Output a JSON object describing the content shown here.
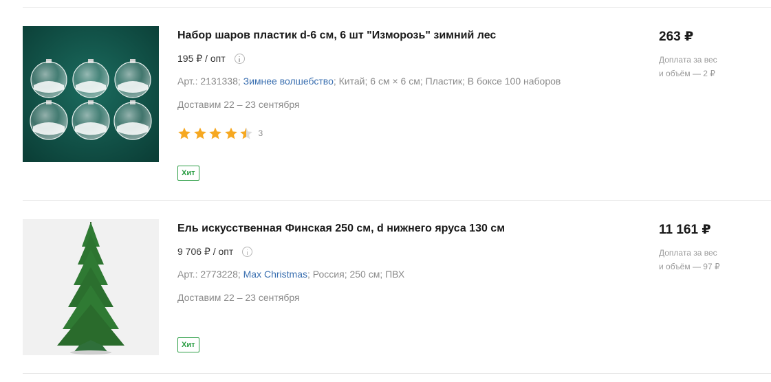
{
  "products": [
    {
      "title": "Набор шаров пластик d-6 см, 6 шт \"Изморозь\" зимний лес",
      "opt_price": "195 ₽ / опт",
      "article": "Арт.: 2131338;",
      "brand": "Зимнее волшебство",
      "attrs_rest": "; Китай; 6 см × 6 см; Пластик; В боксе 100 наборов",
      "delivery": "Доставим 22 – 23 сентября",
      "rating": 4.5,
      "rating_count": "3",
      "badge": "Хит",
      "price": "263 ₽",
      "extra_line1": "Доплата за вес",
      "extra_line2": "и объём — 2 ₽"
    },
    {
      "title": "Ель искусственная Финская 250 см, d нижнего яруса 130 см",
      "opt_price": "9 706 ₽ / опт",
      "article": "Арт.: 2773228;",
      "brand": "Max Christmas",
      "attrs_rest": "; Россия; 250 см; ПВХ",
      "delivery": "Доставим 22 – 23 сентября",
      "badge": "Хит",
      "price": "11 161 ₽",
      "extra_line1": "Доплата за вес",
      "extra_line2": "и объём — 97 ₽"
    }
  ],
  "icons": {
    "info": "info-circle-icon",
    "star": "star-icon"
  },
  "colors": {
    "brand_link": "#3a6fb0",
    "badge_green": "#2a9d43",
    "star": "#f6a821"
  }
}
